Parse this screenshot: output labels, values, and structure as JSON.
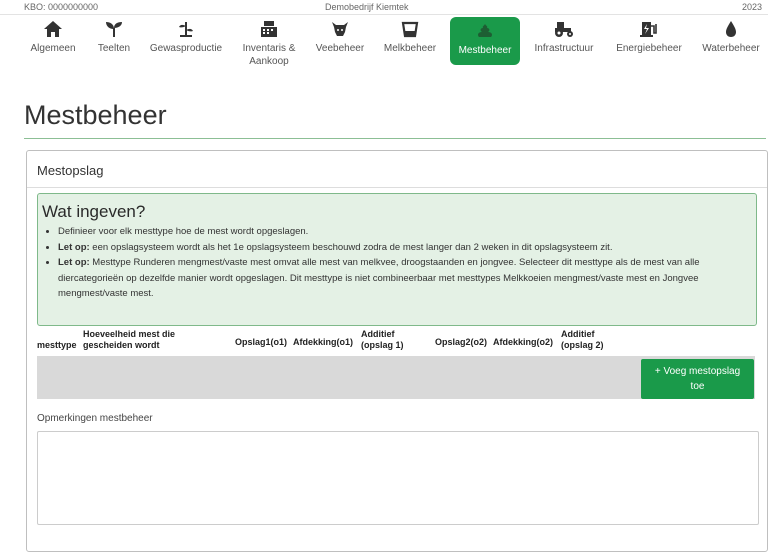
{
  "topbar": {
    "left": "KBO: 0000000000",
    "middle": "Demobedrijf Kiemtek",
    "right": "2023"
  },
  "nav": [
    {
      "label": "Algemeen",
      "icon": "home-icon"
    },
    {
      "label": "Teelten",
      "icon": "sprout-icon"
    },
    {
      "label": "Gewasproductie",
      "icon": "plant-icon"
    },
    {
      "label": "Inventaris & Aankoop",
      "icon": "cash-register-icon"
    },
    {
      "label": "Veebeheer",
      "icon": "cow-icon"
    },
    {
      "label": "Melkbeheer",
      "icon": "bucket-icon"
    },
    {
      "label": "Mestbeheer",
      "icon": "manure-icon",
      "active": true
    },
    {
      "label": "Infrastructuur",
      "icon": "tractor-icon"
    },
    {
      "label": "Energiebeheer",
      "icon": "charging-station-icon"
    },
    {
      "label": "Waterbeheer",
      "icon": "water-drop-icon"
    }
  ],
  "page_title": "Mestbeheer",
  "section": {
    "title": "Mestopslag",
    "info": {
      "title": "Wat ingeven?",
      "item1": "Definieer voor elk mesttype hoe de mest wordt opgeslagen.",
      "item2_bold": "Let op:",
      "item2": " een opslagsysteem wordt als het 1e opslagsysteem beschouwd zodra de mest langer dan 2 weken in dit opslagsysteem zit.",
      "item3_bold": "Let op:",
      "item3": " Mesttype Runderen mengmest/vaste mest omvat alle mest van melkvee, droogstaanden en jongvee. Selecteer dit mesttype als de mest van alle diercategorieën op dezelfde manier wordt opgeslagen. Dit mesttype is niet combineerbaar met mesttypes Melkkoeien mengmest/vaste mest en Jongvee mengmest/vaste mest."
    },
    "columns": {
      "mesttype": "mesttype",
      "hoeveelheid": "Hoeveelheid mest die gescheiden wordt",
      "opslag1": "Opslag1(o1)",
      "afdekking1": "Afdekking(o1)",
      "additief1": "Additief (opslag 1)",
      "opslag2": "Opslag2(o2)",
      "afdekking2": "Afdekking(o2)",
      "additief2": "Additief (opslag 2)"
    },
    "add_button": "+ Voeg mestopslag toe"
  },
  "remarks_label": "Opmerkingen mestbeheer",
  "colors": {
    "brand_green": "#1a9a4a",
    "info_bg": "#e4f1e5",
    "info_border": "#7fb98a"
  }
}
